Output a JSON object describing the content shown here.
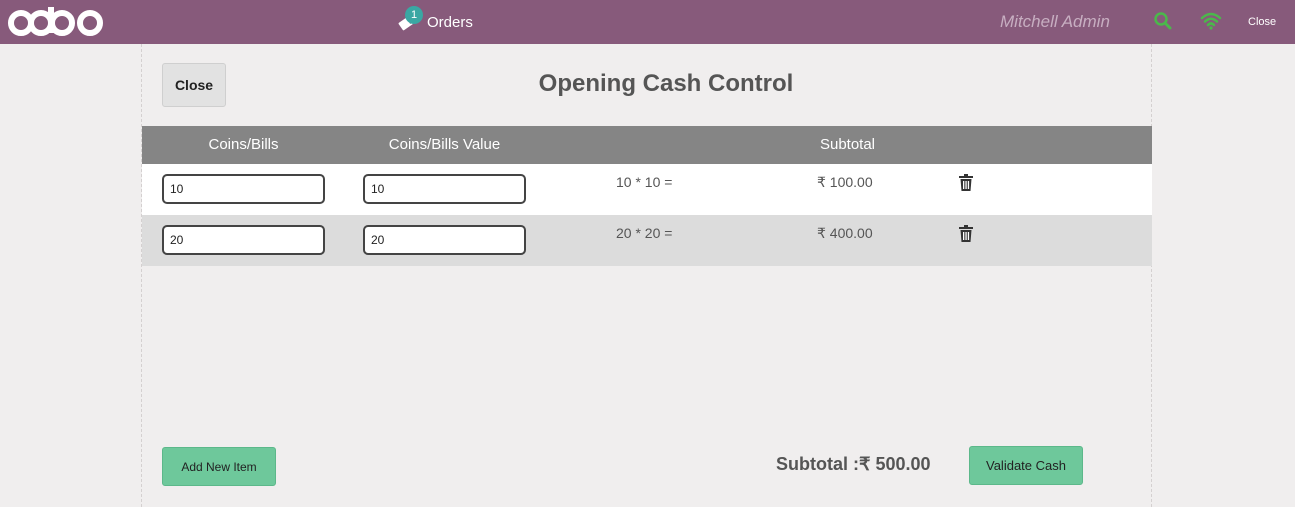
{
  "topbar": {
    "logo": "odoo",
    "orders_label": "Orders",
    "orders_badge": "1",
    "user_name": "Mitchell Admin",
    "close_label": "Close",
    "icons": [
      "ticket-icon",
      "search-icon",
      "wifi-icon"
    ]
  },
  "popup": {
    "close_label": "Close",
    "title": "Opening Cash Control",
    "columns": [
      "Coins/Bills",
      "Coins/Bills Value",
      "Subtotal"
    ],
    "rows": [
      {
        "coins": "10",
        "value": "10",
        "expression": "10 * 10 =",
        "subtotal": "₹ 100.00"
      },
      {
        "coins": "20",
        "value": "20",
        "expression": "20 * 20 =",
        "subtotal": "₹ 400.00"
      }
    ],
    "add_item_label": "Add New Item",
    "total_label": "Subtotal :₹ 500.00",
    "validate_label": "Validate Cash"
  },
  "colors": {
    "topbar": "#875a7b",
    "accent_button": "#6ec89b",
    "header_row": "#858585",
    "success_icon": "#4bb84b"
  }
}
